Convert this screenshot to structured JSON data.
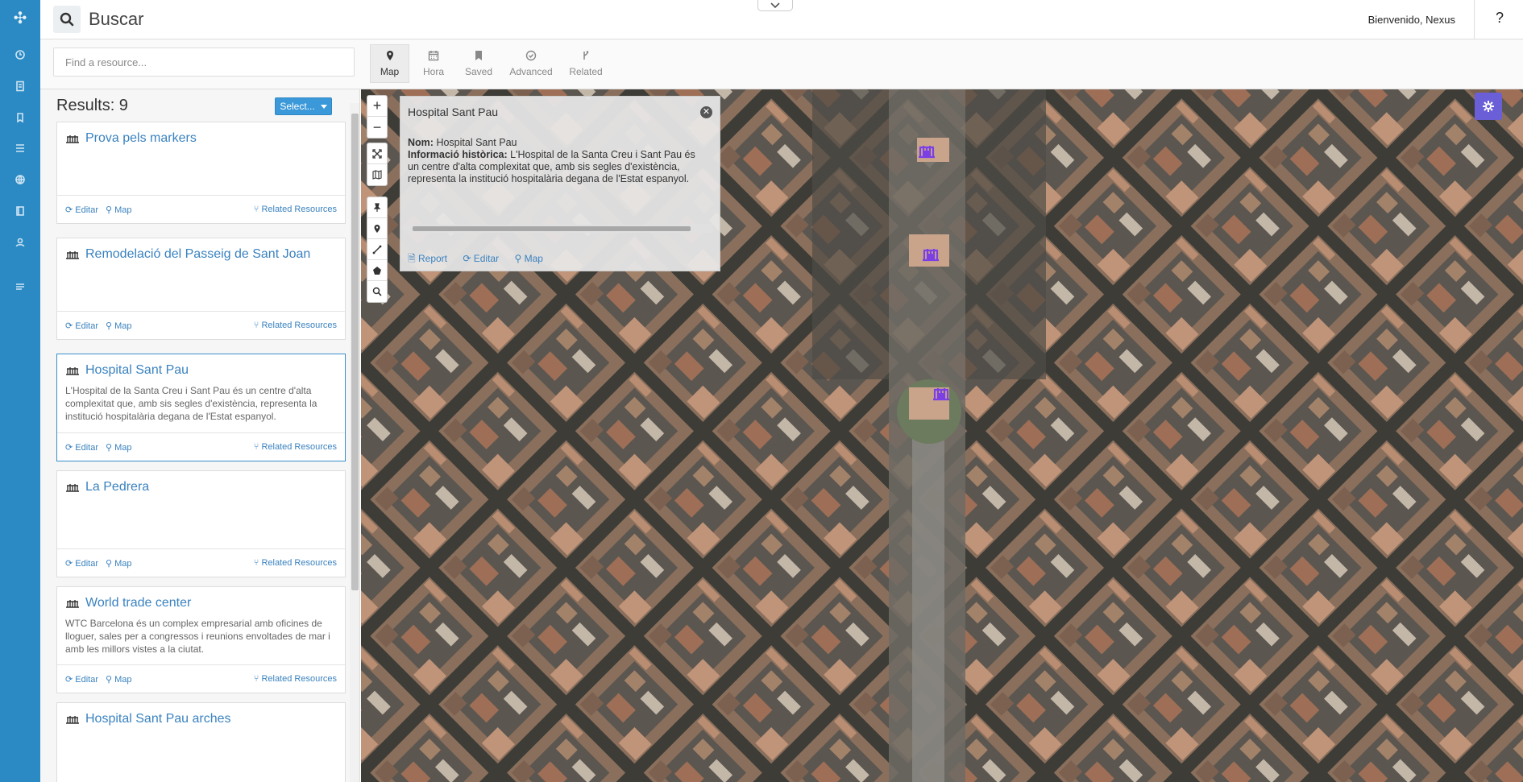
{
  "app": {
    "title": "Buscar",
    "welcome": "Bienvenido, Nexus",
    "help": "?"
  },
  "search": {
    "placeholder": "Find a resource..."
  },
  "filter_tabs": [
    {
      "label": "Map",
      "icon": "map-marker-icon",
      "active": true
    },
    {
      "label": "Hora",
      "icon": "calendar-icon",
      "active": false
    },
    {
      "label": "Saved",
      "icon": "bookmark-icon",
      "active": false
    },
    {
      "label": "Advanced",
      "icon": "check-circle-icon",
      "active": false
    },
    {
      "label": "Related",
      "icon": "branch-icon",
      "active": false
    }
  ],
  "results": {
    "count_label": "Results: 9",
    "select_label": "Select...",
    "items": [
      {
        "title": "Prova pels markers",
        "description": "",
        "edit": "Editar",
        "map": "Map",
        "related": "Related Resources"
      },
      {
        "title": "Remodelació del Passeig de Sant Joan",
        "description": "",
        "edit": "Editar",
        "map": "Map",
        "related": "Related Resources"
      },
      {
        "title": "Hospital Sant Pau",
        "description": "L'Hospital de la Santa Creu i Sant Pau és un centre d'alta complexitat que, amb sis segles d'existència, representa la institució hospitalària degana de l'Estat espanyol.",
        "edit": "Editar",
        "map": "Map",
        "related": "Related Resources",
        "selected": true
      },
      {
        "title": "La Pedrera",
        "description": "",
        "edit": "Editar",
        "map": "Map",
        "related": "Related Resources"
      },
      {
        "title": "World trade center",
        "description": "WTC Barcelona és un complex empresarial amb oficines de lloguer, sales per a congressos i reunions envoltades de mar i amb les millors vistes a la ciutat.",
        "edit": "Editar",
        "map": "Map",
        "related": "Related Resources"
      },
      {
        "title": "Hospital Sant Pau arches",
        "description": "",
        "edit": "Editar",
        "map": "Map",
        "related": "Related Resources"
      }
    ]
  },
  "popup": {
    "title": "Hospital Sant Pau",
    "name_label": "Nom:",
    "name_value": "Hospital Sant Pau",
    "history_label": "Informació històrica:",
    "history_value": "L'Hospital de la Santa Creu i Sant Pau és un centre d'alta complexitat que, amb sis segles d'existència, representa la institució hospitalària degana de l'Estat espanyol.",
    "report": "Report",
    "edit": "Editar",
    "map": "Map"
  },
  "map_controls": {
    "zoom_in": "+",
    "zoom_out": "−"
  },
  "colors": {
    "sidebar": "#2b8ac4",
    "accent": "#3a82bf",
    "marker": "#7b3fe4",
    "settings": "#6b5fd8"
  }
}
